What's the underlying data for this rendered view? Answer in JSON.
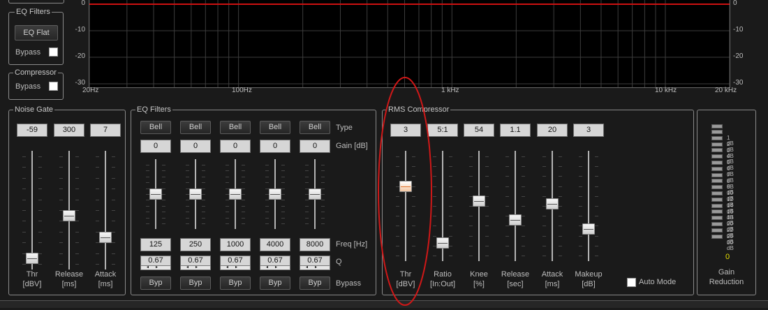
{
  "graph": {
    "y_labels": [
      "0",
      "-10",
      "-20",
      "-30"
    ],
    "x_labels": [
      "20Hz",
      "100Hz",
      "1 kHz",
      "10 kHz",
      "20 kHz"
    ],
    "line_color": "#cc1111"
  },
  "left_panel": {
    "eq_filters_title": "EQ Filters",
    "eq_flat_label": "EQ Flat",
    "bypass_label": "Bypass",
    "compressor_title": "Compressor",
    "compressor_bypass_label": "Bypass"
  },
  "noise_gate": {
    "title": "Noise Gate",
    "values": [
      "-59",
      "300",
      "7"
    ],
    "labels": [
      [
        "Thr",
        "[dBV]"
      ],
      [
        "Release",
        "[ms]"
      ],
      [
        "Attack",
        "[ms]"
      ]
    ],
    "levels": [
      0.05,
      0.45,
      0.25
    ]
  },
  "eq": {
    "title": "EQ Filters",
    "types": [
      "Bell",
      "Bell",
      "Bell",
      "Bell",
      "Bell"
    ],
    "gains": [
      "0",
      "0",
      "0",
      "0",
      "0"
    ],
    "freqs": [
      "125",
      "250",
      "1000",
      "4000",
      "8000"
    ],
    "qs": [
      "0.67",
      "0.67",
      "0.67",
      "0.67",
      "0.67"
    ],
    "bypass_buttons": [
      "Byp",
      "Byp",
      "Byp",
      "Byp",
      "Byp"
    ],
    "row_labels": {
      "type": "Type",
      "gain": "Gain [dB]",
      "freq": "Freq [Hz]",
      "q": "Q",
      "bypass": "Bypass"
    },
    "levels": [
      0.5,
      0.5,
      0.5,
      0.5,
      0.5
    ]
  },
  "compressor": {
    "title": "RMS Compressor",
    "values": [
      "3",
      "5:1",
      "54",
      "1.1",
      "20",
      "3"
    ],
    "labels": [
      [
        "Thr",
        "[dBV]"
      ],
      [
        "Ratio",
        "[In:Out]"
      ],
      [
        "Knee",
        "[%]"
      ],
      [
        "Release",
        "[sec]"
      ],
      [
        "Attack",
        "[ms]"
      ],
      [
        "Makeup",
        "[dB]"
      ]
    ],
    "levels": [
      0.7,
      0.13,
      0.55,
      0.36,
      0.52,
      0.27
    ],
    "auto_mode_label": "Auto Mode"
  },
  "gain_reduction": {
    "labels": [
      "1 dB",
      "2 dB",
      "3 dB",
      "4 dB",
      "5 dB",
      "6 dB",
      "7 dB",
      "8 dB",
      "9 dB",
      "10 dB",
      "12 dB",
      "14 dB",
      "16 dB",
      "18 dB",
      "20 dB",
      "22 dB",
      "25 dB",
      "30 dB"
    ],
    "value": "0",
    "title_line1": "Gain",
    "title_line2": "Reduction",
    "value_color": "#e8e000"
  },
  "annotation_color": "#d01818"
}
